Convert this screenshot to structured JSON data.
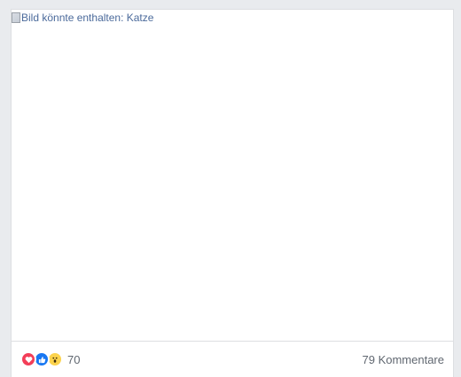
{
  "post": {
    "image_alt": "Bild könnte enthalten: Katze"
  },
  "reactions": {
    "icons": [
      "love-icon",
      "like-icon",
      "wow-icon"
    ],
    "count": "70"
  },
  "comments": {
    "label": "79 Kommentare"
  },
  "colors": {
    "love": "#f33e58",
    "like": "#1877f2",
    "wow": "#fcd34d"
  }
}
